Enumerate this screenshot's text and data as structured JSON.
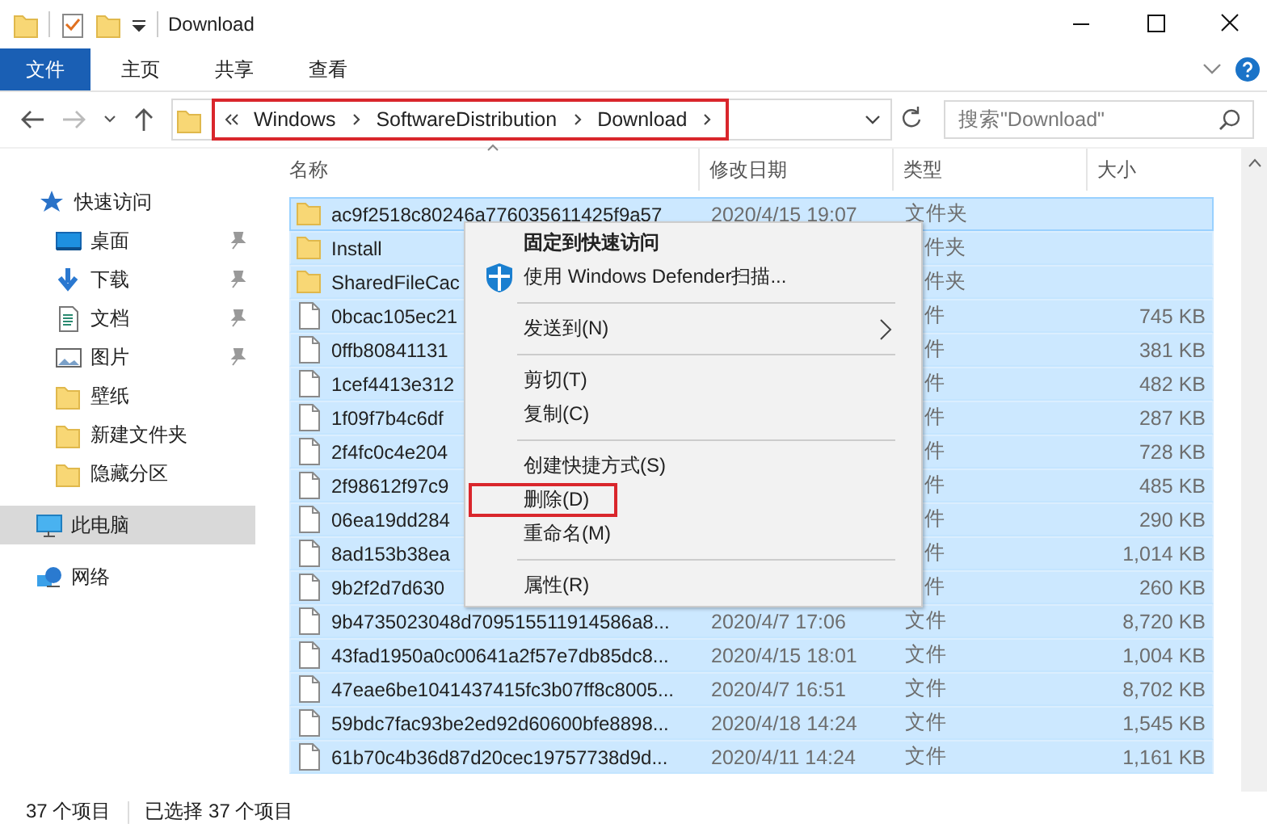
{
  "window": {
    "title": "Download"
  },
  "ribbon_tabs": [
    {
      "label": "文件",
      "selected": true
    },
    {
      "label": "主页",
      "selected": false
    },
    {
      "label": "共享",
      "selected": false
    },
    {
      "label": "查看",
      "selected": false
    }
  ],
  "address_bar": {
    "highlighted": true,
    "crumbs": [
      "Windows",
      "SoftwareDistribution",
      "Download"
    ]
  },
  "search": {
    "placeholder": "搜索\"Download\""
  },
  "sidebar": {
    "items": [
      {
        "label": "快速访问",
        "kind": "star",
        "pinned": false,
        "selected": false
      },
      {
        "label": "桌面",
        "kind": "desktop",
        "pinned": true,
        "selected": false
      },
      {
        "label": "下载",
        "kind": "download",
        "pinned": true,
        "selected": false
      },
      {
        "label": "文档",
        "kind": "document",
        "pinned": true,
        "selected": false
      },
      {
        "label": "图片",
        "kind": "pictures",
        "pinned": true,
        "selected": false
      },
      {
        "label": "壁纸",
        "kind": "folder",
        "pinned": false,
        "selected": false
      },
      {
        "label": "新建文件夹",
        "kind": "folder",
        "pinned": false,
        "selected": false
      },
      {
        "label": "隐藏分区",
        "kind": "folder",
        "pinned": false,
        "selected": false
      },
      {
        "label": "此电脑",
        "kind": "computer",
        "pinned": false,
        "selected": true
      },
      {
        "label": "网络",
        "kind": "network",
        "pinned": false,
        "selected": false
      }
    ]
  },
  "table": {
    "columns": [
      "名称",
      "修改日期",
      "类型",
      "大小"
    ],
    "rows": [
      {
        "kind": "folder",
        "selected": true,
        "name": "ac9f2518c80246a776035611425f9a57",
        "date": "2020/4/15 19:07",
        "type": "文件夹"
      },
      {
        "kind": "folder",
        "selected": true,
        "name": "Install",
        "type": "件夹"
      },
      {
        "kind": "folder",
        "selected": true,
        "name": "SharedFileCac",
        "type": "件夹"
      },
      {
        "kind": "file",
        "selected": true,
        "name": "0bcac105ec21",
        "type": "件",
        "size": "745 KB"
      },
      {
        "kind": "file",
        "selected": true,
        "name": "0ffb80841131",
        "type": "件",
        "size": "381 KB"
      },
      {
        "kind": "file",
        "selected": true,
        "name": "1cef4413e312",
        "type": "件",
        "size": "482 KB"
      },
      {
        "kind": "file",
        "selected": true,
        "name": "1f09f7b4c6df",
        "type": "件",
        "size": "287 KB"
      },
      {
        "kind": "file",
        "selected": true,
        "name": "2f4fc0c4e204",
        "type": "件",
        "size": "728 KB"
      },
      {
        "kind": "file",
        "selected": true,
        "name": "2f98612f97c9",
        "type": "件",
        "size": "485 KB"
      },
      {
        "kind": "file",
        "selected": true,
        "name": "06ea19dd284",
        "type": "件",
        "size": "290 KB"
      },
      {
        "kind": "file",
        "selected": true,
        "name": "8ad153b38ea",
        "type": "件",
        "size": "1,014 KB"
      },
      {
        "kind": "file",
        "selected": true,
        "name": "9b2f2d7d630",
        "type": "件",
        "size": "260 KB"
      },
      {
        "kind": "file",
        "selected": true,
        "name": "9b4735023048d709515511914586a8...",
        "date": "2020/4/7 17:06",
        "type": "文件",
        "size": "8,720 KB"
      },
      {
        "kind": "file",
        "selected": true,
        "name": "43fad1950a0c00641a2f57e7db85dc8...",
        "date": "2020/4/15 18:01",
        "type": "文件",
        "size": "1,004 KB"
      },
      {
        "kind": "file",
        "selected": true,
        "name": "47eae6be1041437415fc3b07ff8c8005...",
        "date": "2020/4/7 16:51",
        "type": "文件",
        "size": "8,702 KB"
      },
      {
        "kind": "file",
        "selected": true,
        "name": "59bdc7fac93be2ed92d60600bfe8898...",
        "date": "2020/4/18 14:24",
        "type": "文件",
        "size": "1,545 KB"
      },
      {
        "kind": "file",
        "selected": true,
        "name": "61b70c4b36d87d20cec19757738d9d...",
        "date": "2020/4/11 14:24",
        "type": "文件",
        "size": "1,161 KB"
      }
    ]
  },
  "context_menu": {
    "items": [
      {
        "kind": "item",
        "label": "固定到快速访问",
        "bold": true,
        "highlighted": false
      },
      {
        "kind": "shield",
        "label": "使用 Windows Defender扫描...",
        "bold": false,
        "highlighted": false
      },
      {
        "kind": "separator"
      },
      {
        "kind": "submenu",
        "label": "发送到(N)",
        "bold": false,
        "highlighted": false
      },
      {
        "kind": "separator"
      },
      {
        "kind": "item",
        "label": "剪切(T)",
        "bold": false,
        "highlighted": false
      },
      {
        "kind": "item",
        "label": "复制(C)",
        "bold": false,
        "highlighted": false
      },
      {
        "kind": "separator"
      },
      {
        "kind": "item",
        "label": "创建快捷方式(S)",
        "bold": false,
        "highlighted": false
      },
      {
        "kind": "item",
        "label": "删除(D)",
        "bold": false,
        "highlighted": true
      },
      {
        "kind": "item",
        "label": "重命名(M)",
        "bold": false,
        "highlighted": false
      },
      {
        "kind": "separator"
      },
      {
        "kind": "item",
        "label": "属性(R)",
        "bold": false,
        "highlighted": false
      }
    ]
  },
  "status_bar": {
    "item_count": "37 个项目",
    "selected_count": "已选择 37 个项目"
  }
}
